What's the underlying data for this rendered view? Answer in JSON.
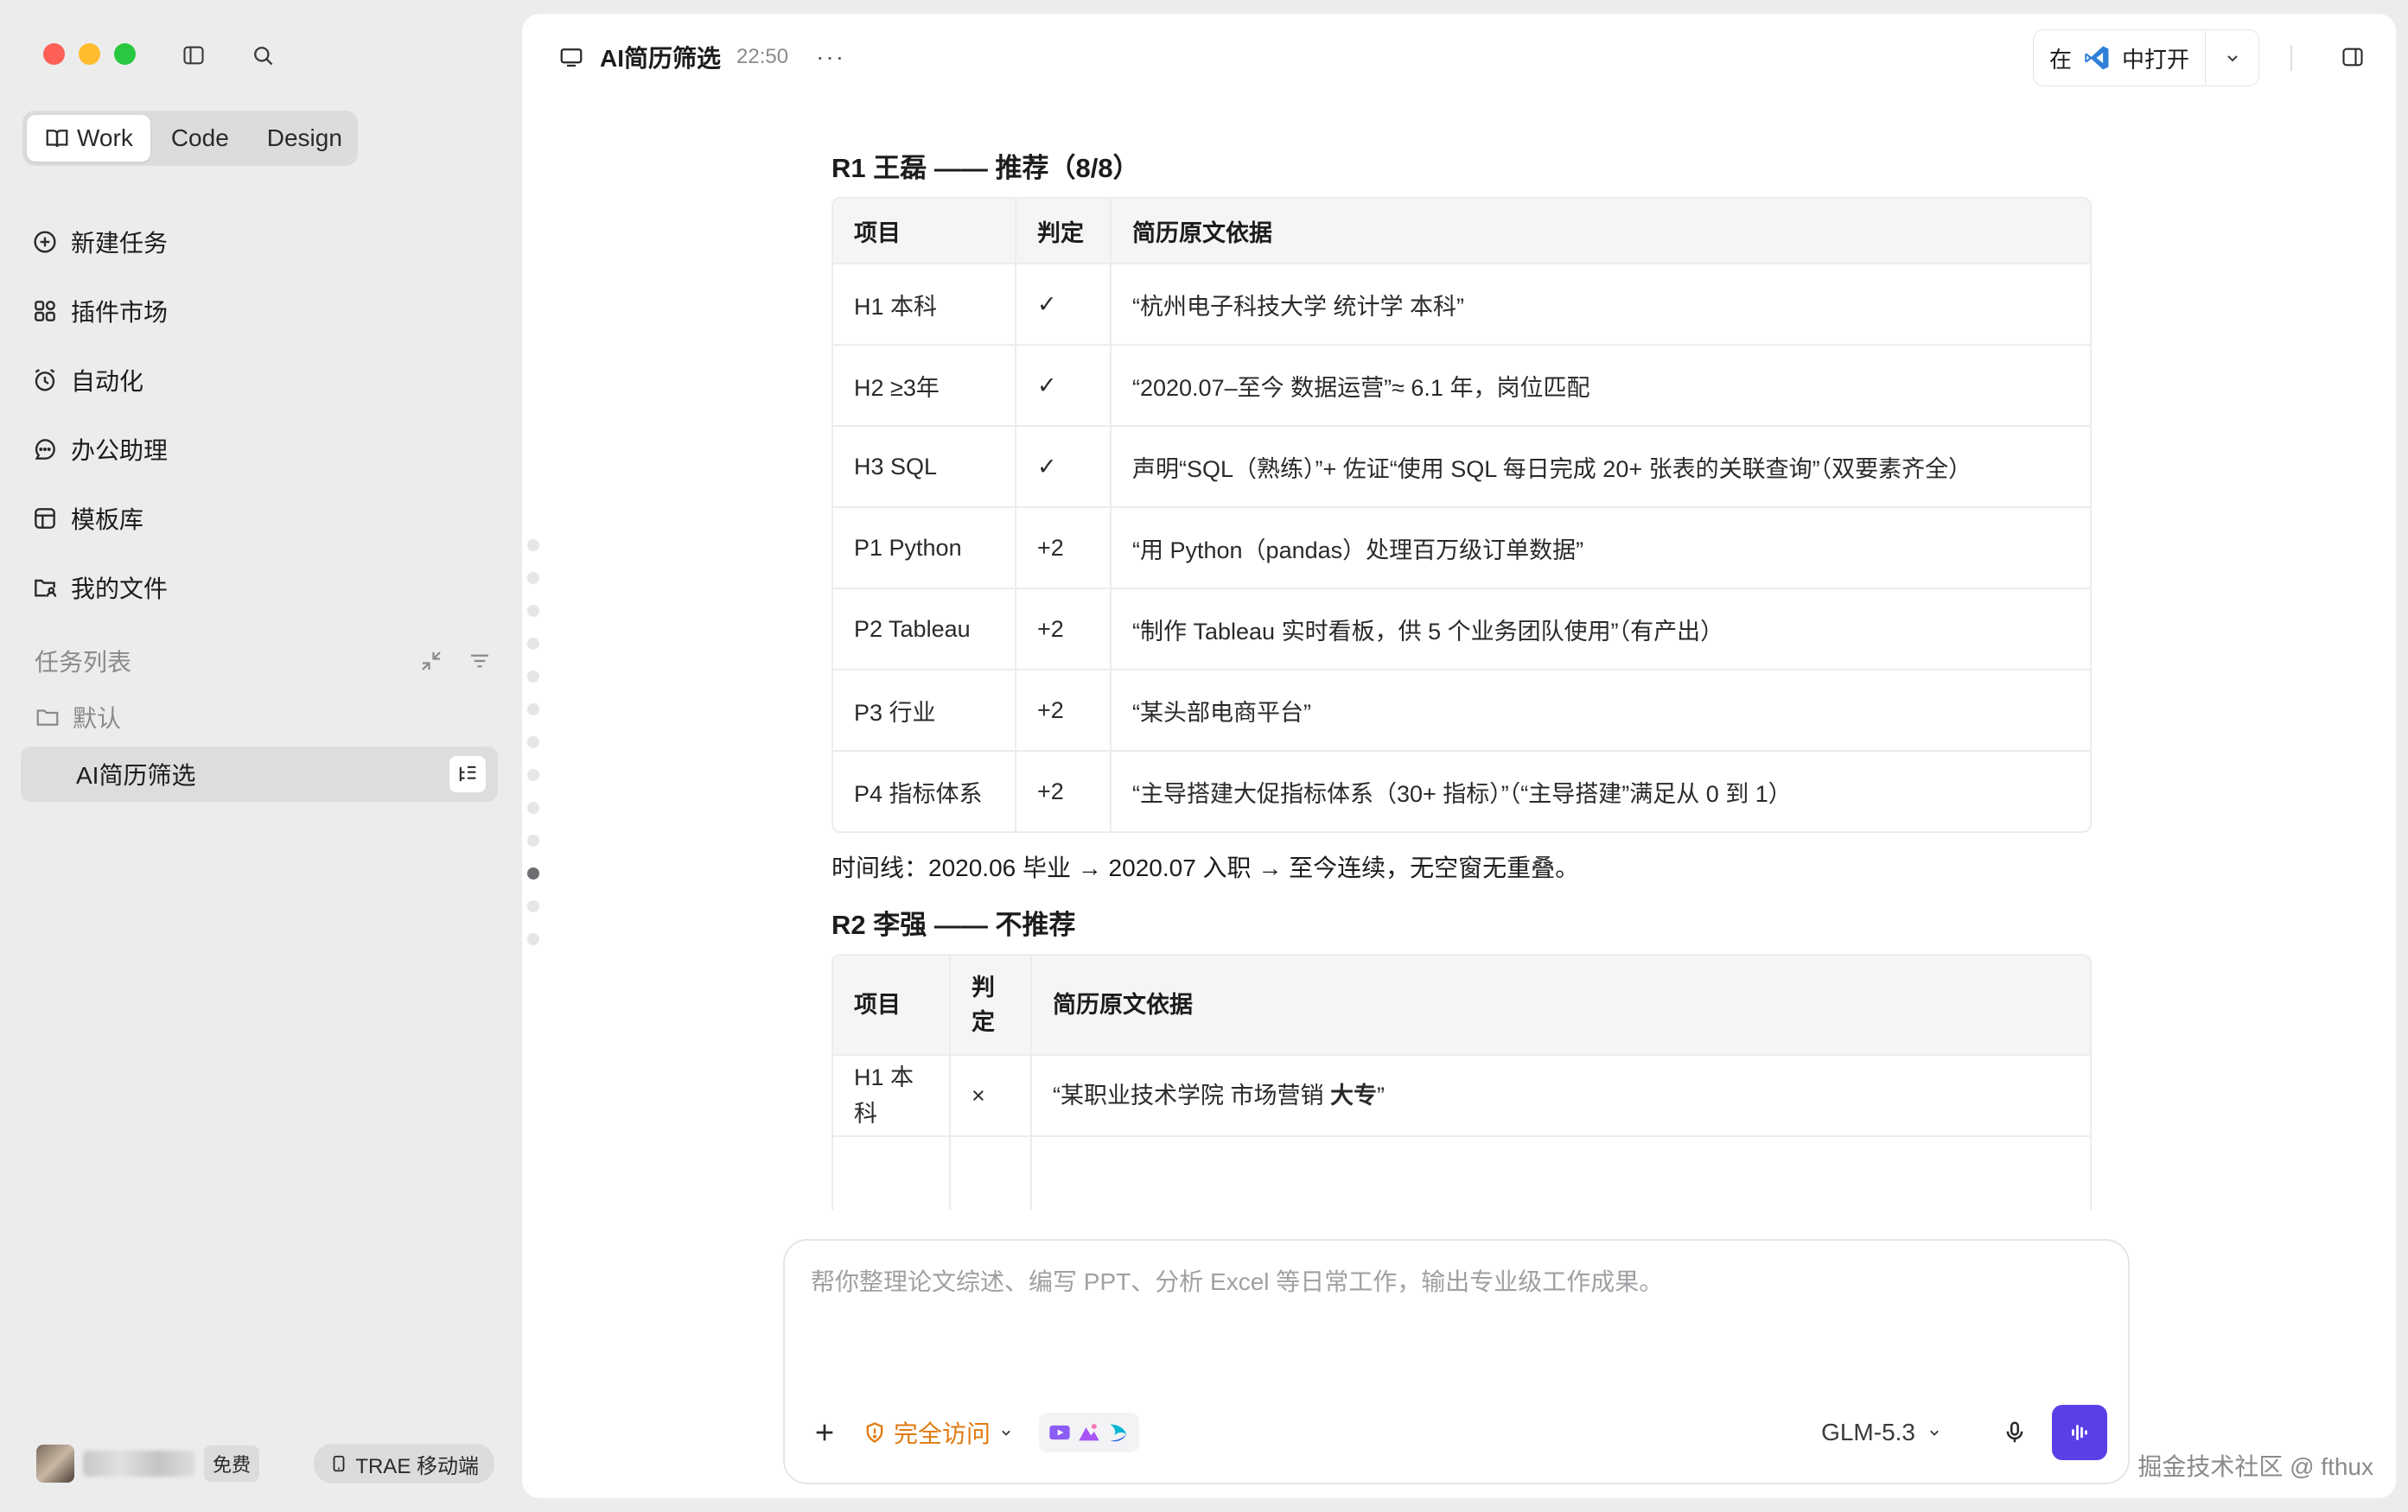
{
  "window": {
    "title": "AI简历筛选",
    "time": "22:50"
  },
  "sidebar": {
    "mode_tabs": [
      "Work",
      "Code",
      "Design"
    ],
    "nav": [
      {
        "label": "新建任务",
        "icon": "plus-circle-icon"
      },
      {
        "label": "插件市场",
        "icon": "plugin-grid-icon"
      },
      {
        "label": "自动化",
        "icon": "alarm-clock-icon"
      },
      {
        "label": "办公助理",
        "icon": "chat-bubble-icon"
      },
      {
        "label": "模板库",
        "icon": "template-icon"
      },
      {
        "label": "我的文件",
        "icon": "user-folder-icon"
      }
    ],
    "task_section": "任务列表",
    "folder": "默认",
    "active_task": "AI简历筛选",
    "free_badge": "免费",
    "mobile_button": "TRAE 移动端"
  },
  "header": {
    "open_prefix": "在",
    "open_suffix": "中打开",
    "more": "···"
  },
  "r1": {
    "title": "R1 王磊 —— 推荐（8/8）",
    "headers": [
      "项目",
      "判定",
      "简历原文依据"
    ],
    "rows": [
      [
        "H1 本科",
        "✓",
        "“杭州电子科技大学 统计学 本科”"
      ],
      [
        "H2 ≥3年",
        "✓",
        "“2020.07–至今 数据运营”≈ 6.1 年，岗位匹配"
      ],
      [
        "H3 SQL",
        "✓",
        "声明“SQL（熟练）”+ 佐证“使用 SQL 每日完成 20+ 张表的关联查询”（双要素齐全）"
      ],
      [
        "P1 Python",
        "+2",
        "“用 Python（pandas）处理百万级订单数据”"
      ],
      [
        "P2 Tableau",
        "+2",
        "“制作 Tableau 实时看板，供 5 个业务团队使用”（有产出）"
      ],
      [
        "P3 行业",
        "+2",
        "“某头部电商平台”"
      ],
      [
        "P4 指标体系",
        "+2",
        "“主导搭建大促指标体系（30+ 指标）”（“主导搭建”满足从 0 到 1）"
      ]
    ]
  },
  "timeline": "时间线：2020.06 毕业 → 2020.07 入职 → 至今连续，无空窗无重叠。",
  "r2": {
    "title": "R2 李强 —— 不推荐",
    "headers": [
      "项目",
      "判定",
      "简历原文依据"
    ],
    "row": {
      "item": "H1 本科",
      "verdict": "×",
      "evidence_prefix": "“某职业技术学院 市场营销 ",
      "evidence_bold": "大专",
      "evidence_suffix": "”"
    }
  },
  "composer": {
    "placeholder": "帮你整理论文综述、编写 PPT、分析 Excel 等日常工作，输出专业级工作成果。",
    "access_label": "完全访问",
    "model": "GLM-5.3"
  },
  "watermark": "掘金技术社区 @ fthux",
  "colors": {
    "accent": "#5b3ee6",
    "access": "#e07a10"
  }
}
